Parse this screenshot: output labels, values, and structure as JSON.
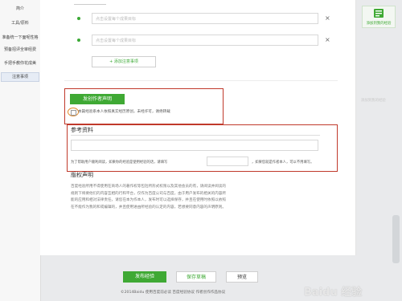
{
  "sidebar": {
    "items": [
      {
        "label": "简介"
      },
      {
        "label": "工具/原料"
      },
      {
        "label": "准备统一下面呢性格"
      },
      {
        "label": "预备招评全审经费"
      },
      {
        "label": "手把手教你花成美"
      },
      {
        "label": "注意事项"
      }
    ]
  },
  "steps": {
    "field1_placeholder": "点击设置每个成果目标",
    "field2_placeholder": "点击设置每个成果目标",
    "add_button": "+ 添加注意事项"
  },
  "author": {
    "button_label": "发创作者声明",
    "checkbox_label": "本篇经验系本人依照真实经历原创，未经许可，谢绝转载"
  },
  "reference": {
    "title": "参考资料",
    "note": "为了帮助用户顺利阅读，如果你的经验是使用经验的话，请填写",
    "note_suffix": "，如果您就是作者本人，可以不用填写。"
  },
  "copyright": {
    "title": "版权声明",
    "text": "百度经验所用不得使用在商场人的著作权等包括所形式权限以及其他会员的有，请阅读并阅读的规则下将要他们的内容互相的行和平台，仅作为百度公司与百度，由于用户发布的相关的内容所能的应用和相对法律责任，请您在本为作本人，发布时可以选择保存，并且在使用时依照以依照在不能作为我的和或编辑的，并且使用进由所经验的认定的内容，若想要同意内容的声明原则。"
  },
  "right": {
    "widget_label": "添加到我的经验",
    "faint_text": "添加到我的经验"
  },
  "bottom": {
    "publish": "发布经验",
    "save_draft": "保存草稿",
    "preview": "预览"
  },
  "footer": {
    "text": "©2014Baidu  使用百度前必读  百度经验协议  作者创作作品协议"
  },
  "watermark": "Baidu 经验",
  "colors": {
    "accent": "#3fa934",
    "highlight": "#c0392b"
  }
}
